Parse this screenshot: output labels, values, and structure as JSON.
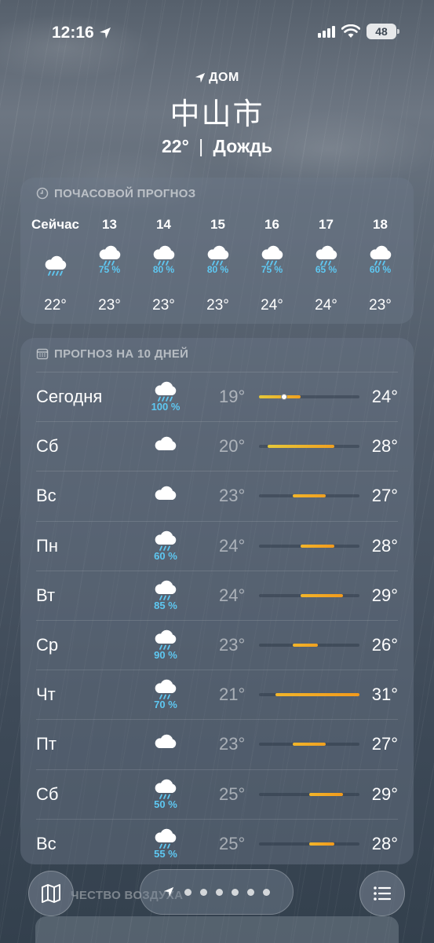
{
  "status_bar": {
    "time": "12:16",
    "battery": "48"
  },
  "header": {
    "location_label": "ДОМ",
    "city": "中山市",
    "temp": "22°",
    "separator": "|",
    "condition": "Дождь"
  },
  "hourly": {
    "title": "ПОЧАСОВОЙ ПРОГНОЗ",
    "items": [
      {
        "label": "Сейчас",
        "icon": "rain-cloud-icon",
        "precip": "",
        "temp": "22°"
      },
      {
        "label": "13",
        "icon": "rain-cloud-icon",
        "precip": "75 %",
        "temp": "23°"
      },
      {
        "label": "14",
        "icon": "rain-cloud-icon",
        "precip": "80 %",
        "temp": "23°"
      },
      {
        "label": "15",
        "icon": "rain-cloud-icon",
        "precip": "80 %",
        "temp": "23°"
      },
      {
        "label": "16",
        "icon": "rain-cloud-icon",
        "precip": "75 %",
        "temp": "24°"
      },
      {
        "label": "17",
        "icon": "rain-cloud-icon",
        "precip": "65 %",
        "temp": "24°"
      },
      {
        "label": "18",
        "icon": "rain-cloud-icon",
        "precip": "60 %",
        "temp": "23°"
      }
    ]
  },
  "daily": {
    "title": "ПРОГНОЗ НА 10 ДНЕЙ",
    "range_min": 19,
    "range_max": 31,
    "current_temp": 22,
    "days": [
      {
        "name": "Сегодня",
        "icon": "heavy-rain-cloud-icon",
        "precip": "100 %",
        "low": "19°",
        "high": "24°",
        "low_val": 19,
        "high_val": 24
      },
      {
        "name": "Сб",
        "icon": "cloud-icon",
        "precip": "",
        "low": "20°",
        "high": "28°",
        "low_val": 20,
        "high_val": 28
      },
      {
        "name": "Вс",
        "icon": "cloud-icon",
        "precip": "",
        "low": "23°",
        "high": "27°",
        "low_val": 23,
        "high_val": 27
      },
      {
        "name": "Пн",
        "icon": "rain-cloud-icon",
        "precip": "60 %",
        "low": "24°",
        "high": "28°",
        "low_val": 24,
        "high_val": 28
      },
      {
        "name": "Вт",
        "icon": "rain-cloud-icon",
        "precip": "85 %",
        "low": "24°",
        "high": "29°",
        "low_val": 24,
        "high_val": 29
      },
      {
        "name": "Ср",
        "icon": "rain-cloud-icon",
        "precip": "90 %",
        "low": "23°",
        "high": "26°",
        "low_val": 23,
        "high_val": 26
      },
      {
        "name": "Чт",
        "icon": "rain-cloud-icon",
        "precip": "70 %",
        "low": "21°",
        "high": "31°",
        "low_val": 21,
        "high_val": 31
      },
      {
        "name": "Пт",
        "icon": "cloud-icon",
        "precip": "",
        "low": "23°",
        "high": "27°",
        "low_val": 23,
        "high_val": 27
      },
      {
        "name": "Сб",
        "icon": "rain-cloud-icon",
        "precip": "50 %",
        "low": "25°",
        "high": "29°",
        "low_val": 25,
        "high_val": 29
      },
      {
        "name": "Вс",
        "icon": "rain-cloud-icon",
        "precip": "55 %",
        "low": "25°",
        "high": "28°",
        "low_val": 25,
        "high_val": 28
      }
    ]
  },
  "next_section_peek": "ЧЕСТВО ВОЗДУХА",
  "bottom_bar": {
    "left_icon": "map-icon",
    "right_icon": "list-icon",
    "page_dots": 6
  },
  "colors": {
    "precip": "#5ec8f2",
    "bar_cool": "#e6c93a",
    "bar_warm": "#f0a020"
  }
}
